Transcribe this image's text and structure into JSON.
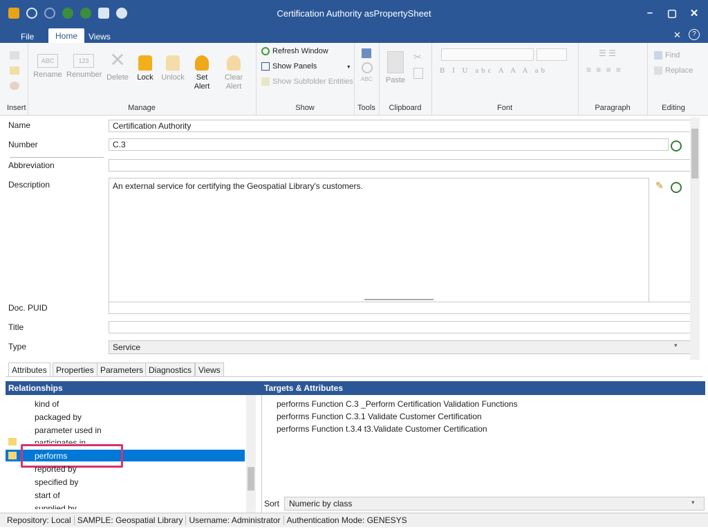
{
  "window": {
    "title": "Certification Authority asPropertySheet"
  },
  "menu": {
    "tabs": [
      {
        "label": "File"
      },
      {
        "label": "Home"
      },
      {
        "label": "Views"
      }
    ]
  },
  "ribbon": {
    "insert": {
      "label": "Insert"
    },
    "manage": {
      "label": "Manage",
      "rename": "Rename",
      "renumber": "Renumber",
      "delete": "Delete",
      "lock": "Lock",
      "unlock": "Unlock",
      "set_alert": "Set Alert",
      "clear_alert": "Clear Alert"
    },
    "show": {
      "label": "Show",
      "refresh": "Refresh Window",
      "panels": "Show Panels",
      "subfolder": "Show Subfolder Entities"
    },
    "tools": {
      "label": "Tools"
    },
    "clipboard": {
      "label": "Clipboard",
      "paste": "Paste"
    },
    "font": {
      "label": "Font"
    },
    "paragraph": {
      "label": "Paragraph"
    },
    "editing": {
      "label": "Editing",
      "find": "Find",
      "replace": "Replace"
    }
  },
  "form": {
    "name": {
      "label": "Name",
      "value": "Certification Authority"
    },
    "number": {
      "label": "Number",
      "value": "C.3"
    },
    "abbreviation": {
      "label": "Abbreviation",
      "value": ""
    },
    "description": {
      "label": "Description",
      "value": "An external service for certifying the Geospatial Library's customers."
    },
    "doc_puid": {
      "label": "Doc. PUID",
      "value": ""
    },
    "title": {
      "label": "Title",
      "value": ""
    },
    "type": {
      "label": "Type",
      "value": "Service"
    }
  },
  "tabs": [
    {
      "label": "Attributes"
    },
    {
      "label": "Properties"
    },
    {
      "label": "Parameters"
    },
    {
      "label": "Diagnostics"
    },
    {
      "label": "Views"
    }
  ],
  "relationships": {
    "header": "Relationships",
    "items": [
      "kind of",
      "packaged by",
      "parameter used in",
      "participates in",
      "performs",
      "reported by",
      "specified by",
      "start of",
      "supplied by"
    ]
  },
  "targets": {
    "header": "Targets & Attributes",
    "items": [
      "performs Function C.3 _Perform Certification Validation Functions",
      "performs Function C.3.1 Validate Customer Certification",
      "performs Function t.3.4 t3.Validate Customer Certification"
    ],
    "sort_label": "Sort",
    "sort_value": "Numeric by class"
  },
  "status": {
    "repository": "Repository: Local",
    "sample": "SAMPLE: Geospatial Library",
    "user": "Username: Administrator",
    "auth": "Authentication Mode: GENESYS"
  },
  "colors": {
    "accent": "#2b5797",
    "selection": "#0078d7",
    "highlight": "#d6336c"
  }
}
